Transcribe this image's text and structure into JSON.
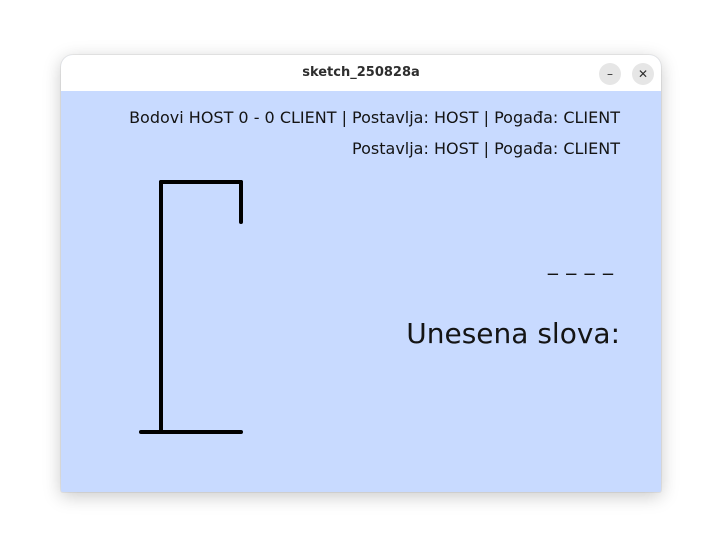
{
  "window": {
    "title": "sketch_250828a",
    "minimize_glyph": "–",
    "close_glyph": "✕"
  },
  "game": {
    "score_line": "Bodovi HOST 0 - 0 CLIENT | Postavlja: HOST | Pogađa: CLIENT",
    "roles_line": "Postavlja: HOST | Pogađa: CLIENT",
    "word_mask": "_ _ _ _",
    "guessed_letters_label": "Unesena slova:"
  },
  "colors": {
    "canvas_bg": "#c8daff",
    "stroke": "#000000"
  }
}
